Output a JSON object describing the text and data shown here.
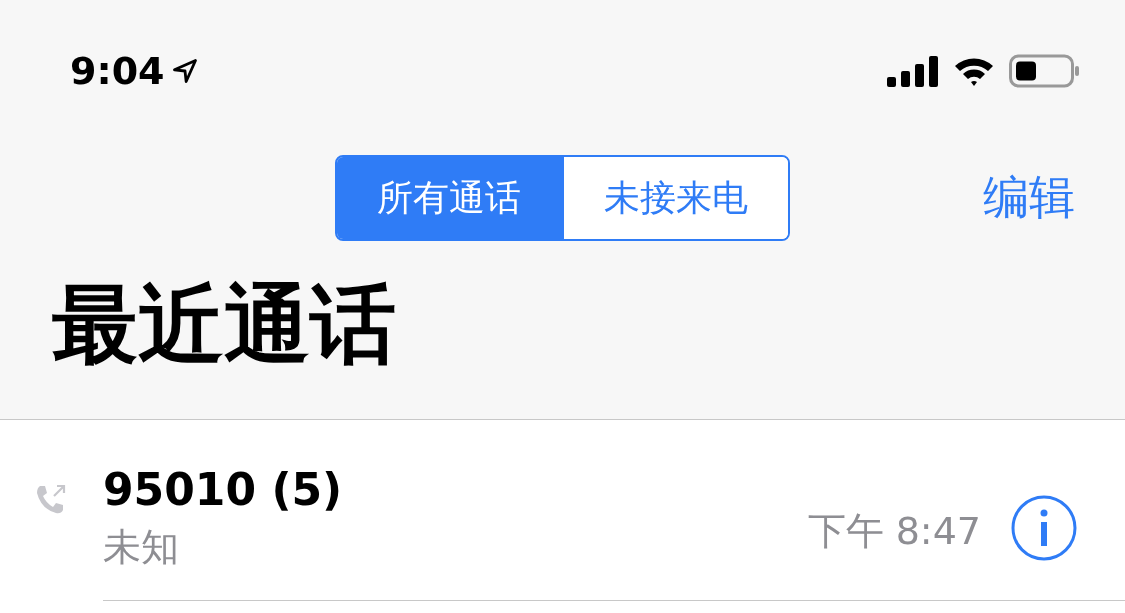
{
  "status_bar": {
    "time": "9:04"
  },
  "segments": [
    {
      "label": "所有通话",
      "selected": true
    },
    {
      "label": "未接来电",
      "selected": false
    }
  ],
  "edit_button": "编辑",
  "title": "最近通话",
  "calls": [
    {
      "name": "95010 (5)",
      "missed": false,
      "subtitle": "未知",
      "time": "下午 8:47"
    }
  ]
}
